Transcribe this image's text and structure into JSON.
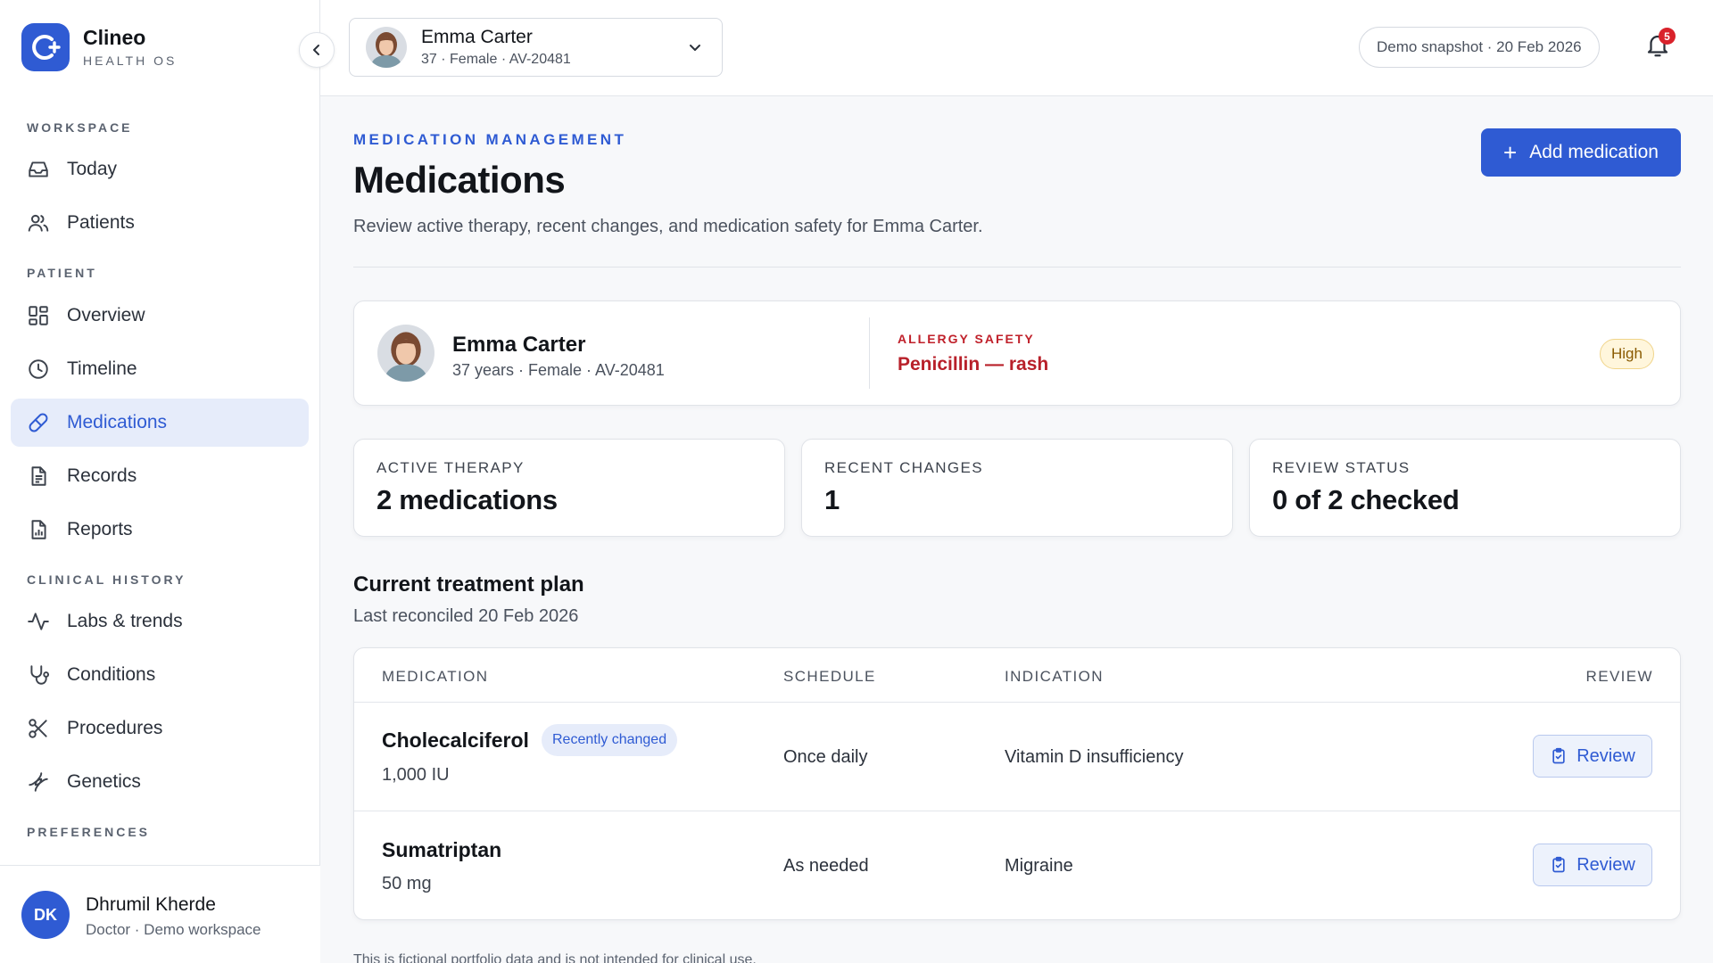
{
  "brand": {
    "name": "Clineo",
    "subtitle": "HEALTH OS"
  },
  "sidebar": {
    "sections": {
      "workspace": "WORKSPACE",
      "patient": "PATIENT",
      "clinical_history": "CLINICAL HISTORY",
      "preferences": "PREFERENCES"
    },
    "items": [
      {
        "label": "Today",
        "icon": "inbox-icon"
      },
      {
        "label": "Patients",
        "icon": "users-icon"
      },
      {
        "label": "Overview",
        "icon": "grid-icon"
      },
      {
        "label": "Timeline",
        "icon": "clock-icon"
      },
      {
        "label": "Medications",
        "icon": "pill-icon",
        "active": true
      },
      {
        "label": "Records",
        "icon": "document-icon"
      },
      {
        "label": "Reports",
        "icon": "report-icon"
      },
      {
        "label": "Labs & trends",
        "icon": "activity-icon"
      },
      {
        "label": "Conditions",
        "icon": "stethoscope-icon"
      },
      {
        "label": "Procedures",
        "icon": "scissors-icon"
      },
      {
        "label": "Genetics",
        "icon": "dna-icon"
      }
    ],
    "user": {
      "initials": "DK",
      "name": "Dhrumil Kherde",
      "role": "Doctor · Demo workspace"
    }
  },
  "topbar": {
    "patient": {
      "name": "Emma Carter",
      "meta": "37 · Female · AV-20481"
    },
    "snapshot": "Demo snapshot · 20 Feb 2026",
    "notifications": "5"
  },
  "page": {
    "eyebrow": "MEDICATION MANAGEMENT",
    "title": "Medications",
    "subtitle": "Review active therapy, recent changes, and medication safety for Emma Carter.",
    "add_button": "Add medication"
  },
  "patient_card": {
    "name": "Emma Carter",
    "meta": "37 years · Female · AV-20481",
    "allergy_label": "ALLERGY SAFETY",
    "allergy_value": "Penicillin — rash",
    "severity": "High"
  },
  "stats": [
    {
      "label": "ACTIVE THERAPY",
      "value": "2 medications"
    },
    {
      "label": "RECENT CHANGES",
      "value": "1"
    },
    {
      "label": "REVIEW STATUS",
      "value": "0 of 2 checked"
    }
  ],
  "plan": {
    "title": "Current treatment plan",
    "subtitle": "Last reconciled 20 Feb 2026",
    "columns": {
      "medication": "MEDICATION",
      "schedule": "SCHEDULE",
      "indication": "INDICATION",
      "review": "REVIEW"
    },
    "rows": [
      {
        "name": "Cholecalciferol",
        "badge": "Recently changed",
        "dose": "1,000 IU",
        "schedule": "Once daily",
        "indication": "Vitamin D insufficiency",
        "review": "Review"
      },
      {
        "name": "Sumatriptan",
        "dose": "50 mg",
        "schedule": "As needed",
        "indication": "Migraine",
        "review": "Review"
      }
    ]
  },
  "footnote": "This is fictional portfolio data and is not intended for clinical use.",
  "colors": {
    "accent": "#2f5bd3",
    "danger": "#c0212b",
    "warning_bg": "#fff6dc"
  }
}
